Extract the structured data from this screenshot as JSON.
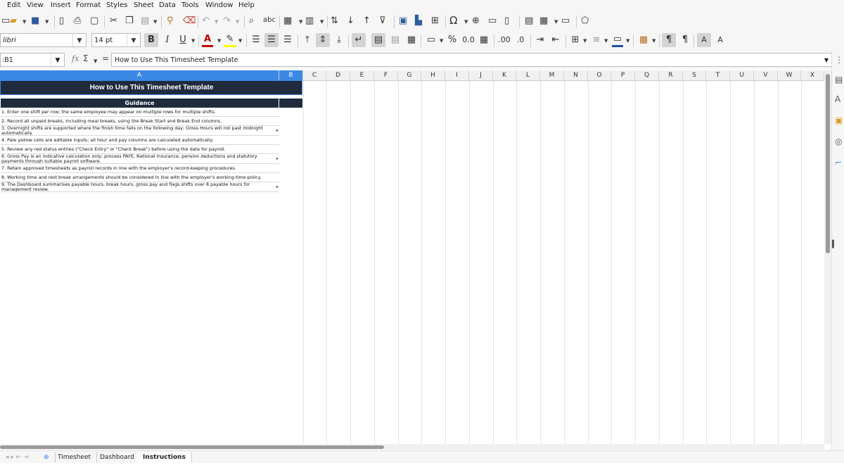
{
  "menu": [
    "Edit",
    "View",
    "Insert",
    "Format",
    "Styles",
    "Sheet",
    "Data",
    "Tools",
    "Window",
    "Help"
  ],
  "toolbar2": {
    "font_name": "libri",
    "font_size": "14 pt",
    "bold": "B",
    "italic": "I",
    "underline": "U",
    "percent": "%",
    "decimal": "0.0"
  },
  "formula_bar": {
    "cell_ref": ":B1",
    "formula": "How to Use This Timesheet Template",
    "fx": "fx",
    "sum": "Σ",
    "equals": "="
  },
  "columns": [
    "A",
    "B",
    "C",
    "D",
    "E",
    "F",
    "G",
    "H",
    "I",
    "J",
    "K",
    "L",
    "M",
    "N",
    "O",
    "P",
    "Q",
    "R",
    "S",
    "T",
    "U",
    "V",
    "W",
    "X"
  ],
  "sheet": {
    "title": "How to Use This Timesheet Template",
    "guidance_header": "Guidance",
    "rows": [
      "1. Enter one shift per row; the same employee may appear on multiple rows for multiple shifts.",
      "2. Record all unpaid breaks, including meal breaks, using the Break Start and Break End columns.",
      "3. Overnight shifts are supported where the finish time falls on the following day; Gross Hours will roll past midnight automatically.",
      "4. Pale yellow cells are editable inputs; all hour and pay columns are calculated automatically.",
      "5. Review any red status entries (\"Check Entry\" or \"Check Break\") before using the data for payroll.",
      "6. Gross Pay is an indicative calculation only; process PAYE, National Insurance, pension deductions and statutory payments through suitable payroll software.",
      "7. Retain approved timesheets as payroll records in line with the employer's record-keeping procedures.",
      "8. Working time and rest break arrangements should be considered in line with the employer's working-time policy.",
      "9. The Dashboard summarises payable hours, break hours, gross pay and flags shifts over 8 payable hours for management review."
    ]
  },
  "tabs": [
    "Timesheet",
    "Dashboard",
    "Instructions"
  ],
  "active_tab": "Instructions",
  "colors": {
    "header_dark": "#1f2b3d",
    "selection": "#3b87e4"
  }
}
